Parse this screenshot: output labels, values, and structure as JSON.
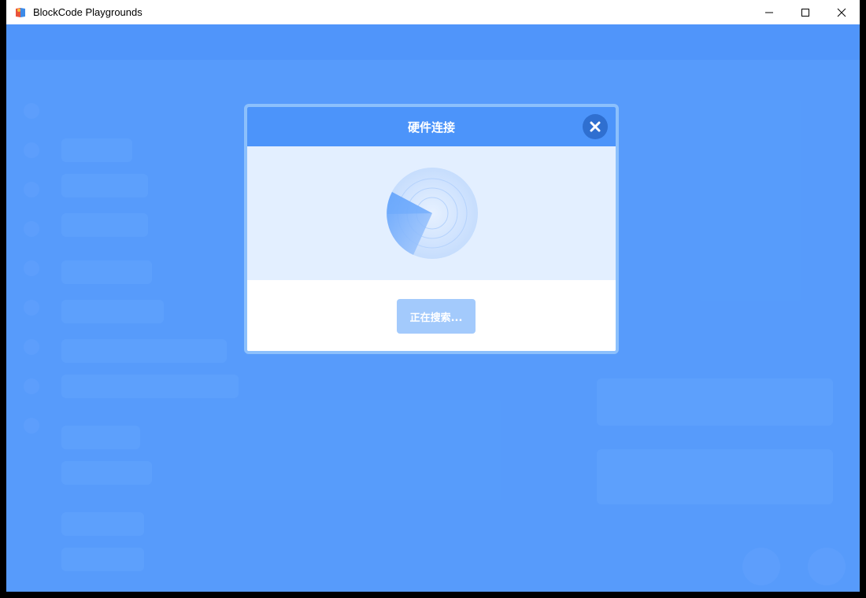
{
  "window": {
    "title": "BlockCode Playgrounds",
    "controls": [
      "minimize",
      "maximize",
      "close"
    ]
  },
  "dialog": {
    "title": "硬件连接",
    "search_button_label": "正在搜索...",
    "close_icon": "close-icon"
  },
  "colors": {
    "header": "#4c94fa",
    "body": "#e3efff",
    "button": "#a3cafc",
    "backdrop": "#5b9ffc"
  }
}
